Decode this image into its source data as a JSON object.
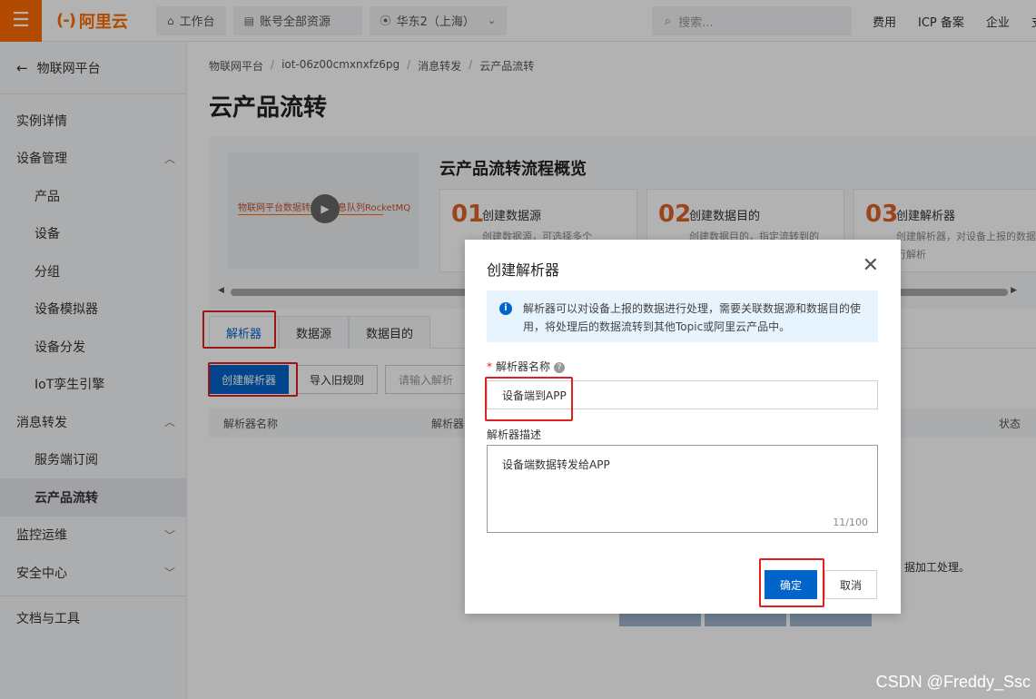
{
  "topbar": {
    "logo_mark": "(-)",
    "logo_text": "阿里云",
    "workbench": "工作台",
    "account": "账号全部资源",
    "region": "华东2（上海）",
    "search_placeholder": "搜索...",
    "links": [
      "费用",
      "ICP 备案",
      "企业",
      "支持"
    ]
  },
  "sidebar": {
    "back": "物联网平台",
    "items": [
      {
        "label": "实例详情"
      },
      {
        "label": "设备管理"
      },
      {
        "label": "产品"
      },
      {
        "label": "设备"
      },
      {
        "label": "分组"
      },
      {
        "label": "设备模拟器"
      },
      {
        "label": "设备分发"
      },
      {
        "label": "IoT孪生引擎"
      },
      {
        "label": "消息转发"
      },
      {
        "label": "服务端订阅"
      },
      {
        "label": "云产品流转"
      },
      {
        "label": "监控运维"
      },
      {
        "label": "安全中心"
      },
      {
        "label": "文档与工具"
      }
    ]
  },
  "breadcrumb": [
    "物联网平台",
    "iot-06z00cmxnxfz6pg",
    "消息转发",
    "云产品流转"
  ],
  "page_title": "云产品流转",
  "overview": {
    "title": "云产品流转流程概览",
    "video_label": "物联网平台数据转发到消息队列RocketMQ",
    "steps": [
      {
        "num": "01",
        "title": "创建数据源",
        "desc": "创建数据源，可选择多个"
      },
      {
        "num": "02",
        "title": "创建数据目的",
        "desc": "创建数据目的，指定流转到的"
      },
      {
        "num": "03",
        "title": "创建解析器",
        "desc": "创建解析器，对设备上报的数据进行解析"
      }
    ]
  },
  "tabs": [
    "解析器",
    "数据源",
    "数据目的"
  ],
  "actions": {
    "create": "创建解析器",
    "import": "导入旧规则",
    "search_placeholder": "请输入解析"
  },
  "table": {
    "headers": [
      "解析器名称",
      "解析器",
      "状态"
    ]
  },
  "empty_tail": "据加工处理。",
  "dialog": {
    "title": "创建解析器",
    "info": "解析器可以对设备上报的数据进行处理，需要关联数据源和数据目的使用，将处理后的数据流转到其他Topic或阿里云产品中。",
    "name_label": "解析器名称",
    "name_value": "设备端到APP",
    "desc_label": "解析器描述",
    "desc_value": "设备端数据转发给APP",
    "desc_count": "11/100",
    "ok": "确定",
    "cancel": "取消"
  },
  "watermark": "CSDN @Freddy_Ssc"
}
